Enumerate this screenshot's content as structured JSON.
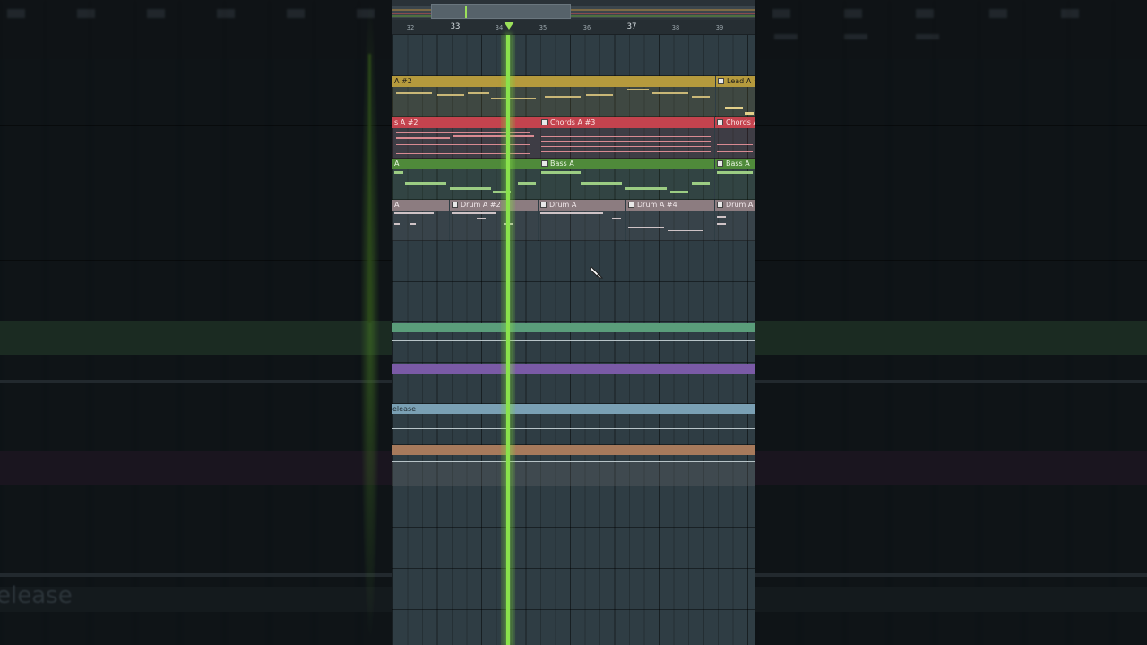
{
  "ruler": {
    "ticks": [
      {
        "label": "32",
        "kind": "minor"
      },
      {
        "label": "33",
        "kind": "major"
      },
      {
        "label": "34",
        "kind": "minor"
      },
      {
        "label": "35",
        "kind": "minor"
      },
      {
        "label": "36",
        "kind": "minor"
      },
      {
        "label": "37",
        "kind": "major"
      },
      {
        "label": "38",
        "kind": "minor"
      },
      {
        "label": "39",
        "kind": "minor"
      }
    ]
  },
  "tracks": {
    "lead": {
      "color": "#b59a3d",
      "clips": [
        "A #2",
        "Lead A #"
      ]
    },
    "chords": {
      "color": "#c4434e",
      "clips": [
        "s A #2",
        "Chords A #3",
        "Chords A"
      ]
    },
    "bass": {
      "color": "#4f8a3a",
      "clips": [
        "A",
        "Bass A",
        "Bass A"
      ]
    },
    "drum": {
      "color": "#8c7c80",
      "clips": [
        "A",
        "Drum A #2",
        "Drum A",
        "Drum A #4",
        "Drum A"
      ]
    }
  },
  "automation": {
    "green_color": "#5a9d7a",
    "purple_color": "#7a5aa6",
    "release_color": "#7aa0b4",
    "release_label": "elease",
    "orange_color": "#a77a5c"
  },
  "background": {
    "big_label": "elease"
  },
  "playhead": {
    "color": "#8ae24c"
  },
  "icons": {
    "clip": "pattern-clip-icon",
    "cursor": "pencil-cursor-icon",
    "marker": "song-position-marker-icon"
  }
}
